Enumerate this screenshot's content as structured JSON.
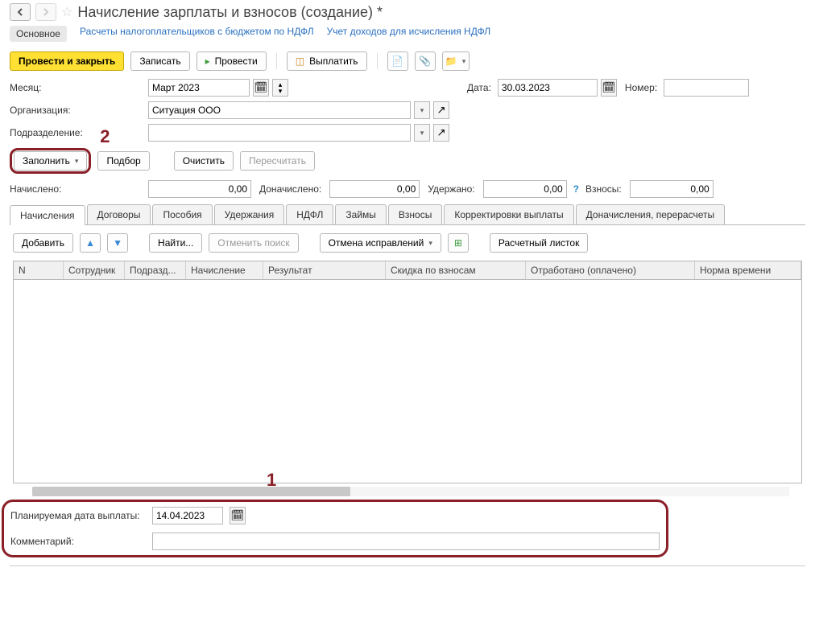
{
  "title": "Начисление зарплаты и взносов (создание) *",
  "nav": {
    "main": "Основное",
    "link1": "Расчеты налогоплательщиков с бюджетом по НДФЛ",
    "link2": "Учет доходов для исчисления НДФЛ"
  },
  "toolbar": {
    "run_close": "Провести и закрыть",
    "save": "Записать",
    "run": "Провести",
    "pay": "Выплатить"
  },
  "form": {
    "month_label": "Месяц:",
    "month_value": "Март 2023",
    "date_label": "Дата:",
    "date_value": "30.03.2023",
    "number_label": "Номер:",
    "number_value": "",
    "org_label": "Организация:",
    "org_value": "Ситуация ООО",
    "dept_label": "Подразделение:",
    "dept_value": ""
  },
  "actions": {
    "fill": "Заполнить",
    "pick": "Подбор",
    "clear": "Очистить",
    "recalc": "Пересчитать"
  },
  "totals": {
    "accrued_label": "Начислено:",
    "accrued": "0,00",
    "extra_label": "Доначислено:",
    "extra": "0,00",
    "withheld_label": "Удержано:",
    "withheld": "0,00",
    "contrib_label": "Взносы:",
    "contrib": "0,00"
  },
  "tabs": {
    "t1": "Начисления",
    "t2": "Договоры",
    "t3": "Пособия",
    "t4": "Удержания",
    "t5": "НДФЛ",
    "t6": "Займы",
    "t7": "Взносы",
    "t8": "Корректировки выплаты",
    "t9": "Доначисления, перерасчеты"
  },
  "sub": {
    "add": "Добавить",
    "find": "Найти...",
    "cancel_find": "Отменить поиск",
    "cancel_fix": "Отмена исправлений",
    "payslip": "Расчетный листок"
  },
  "cols": {
    "c1": "N",
    "c2": "Сотрудник",
    "c3": "Подразд...",
    "c4": "Начисление",
    "c5": "Результат",
    "c6": "Скидка по взносам",
    "c7": "Отработано (оплачено)",
    "c8": "Норма времени"
  },
  "bottom": {
    "plan_label": "Планируемая дата выплаты:",
    "plan_value": "14.04.2023",
    "comment_label": "Комментарий:"
  }
}
